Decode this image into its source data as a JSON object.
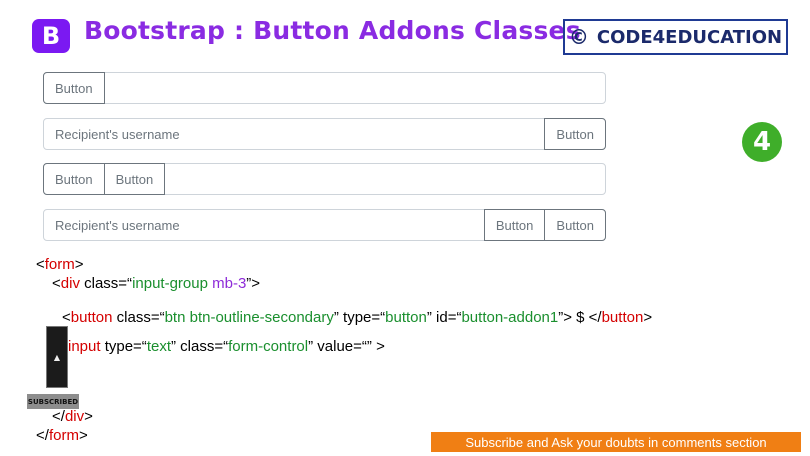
{
  "header": {
    "logo_letter": "B",
    "title": "Bootstrap : Button Addons Classes",
    "brand_symbol": "©",
    "brand_name": "CODE4EDUCATION"
  },
  "groups": [
    {
      "buttons_left": [
        "Button"
      ],
      "placeholder": "",
      "buttons_right": []
    },
    {
      "buttons_left": [],
      "placeholder": "Recipient's username",
      "buttons_right": [
        "Button"
      ]
    },
    {
      "buttons_left": [
        "Button",
        "Button"
      ],
      "placeholder": "",
      "buttons_right": []
    },
    {
      "buttons_left": [],
      "placeholder": "Recipient's username",
      "buttons_right": [
        "Button",
        "Button"
      ]
    }
  ],
  "side_logo": "4",
  "code": {
    "line1_open": "<",
    "line1_tag": "form",
    "line1_close": ">",
    "line2_open": "<",
    "line2_tag": "div",
    "line2_attr": " class=“",
    "line2_val": "input-group",
    "line2_valp": " mb-3",
    "line2_close": "”>",
    "line3_open": "<",
    "line3_tag": "button",
    "line3_attr1": " class=“",
    "line3_val1": "btn btn-outline-secondary",
    "line3_attr2": "” type=“",
    "line3_val2": "button",
    "line3_attr3": "” id=“",
    "line3_val3": "button-addon1",
    "line3_mid": "”> $ </",
    "line3_tag2": "button",
    "line3_close": ">",
    "line4_tag": "input",
    "line4_attr1": " type=“",
    "line4_val1": "text",
    "line4_attr2": "” class=“",
    "line4_val2": "form-control",
    "line4_attr3": "” value=“” >",
    "line5_open": "</",
    "line5_tag": "div",
    "line5_close": ">",
    "line6_open": "</",
    "line6_tag": "form",
    "line6_close": ">"
  },
  "subscribe_badge": "SUBSCRIBED",
  "banner": "Subscribe and Ask your doubts in comments section"
}
